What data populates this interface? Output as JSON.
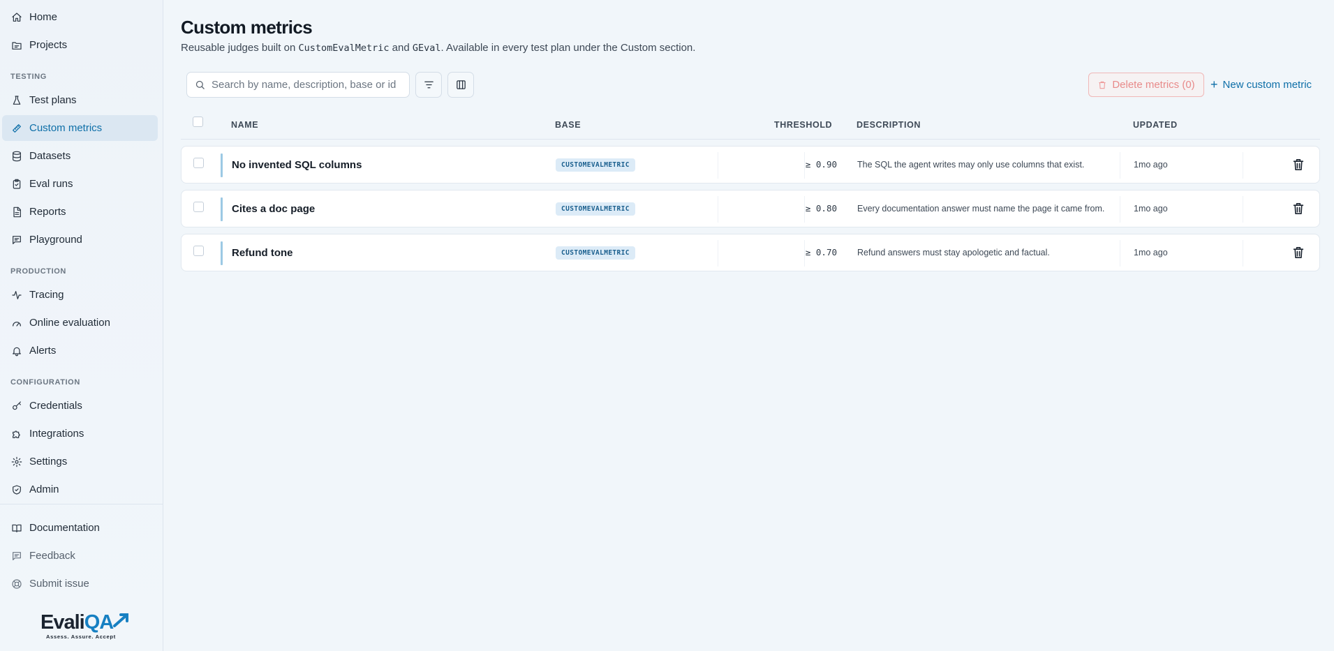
{
  "sidebar": {
    "items_top": [
      {
        "label": "Home",
        "icon": "home-icon"
      },
      {
        "label": "Projects",
        "icon": "projects-icon"
      }
    ],
    "sections": {
      "testing": "TESTING",
      "production": "PRODUCTION",
      "configuration": "CONFIGURATION"
    },
    "testing_items": [
      {
        "label": "Test plans",
        "icon": "flask-icon"
      },
      {
        "label": "Custom metrics",
        "icon": "ruler-icon",
        "active": true
      },
      {
        "label": "Datasets",
        "icon": "database-icon"
      },
      {
        "label": "Eval runs",
        "icon": "clipboard-check-icon"
      },
      {
        "label": "Reports",
        "icon": "file-text-icon"
      },
      {
        "label": "Playground",
        "icon": "chat-icon"
      }
    ],
    "production_items": [
      {
        "label": "Tracing",
        "icon": "activity-icon"
      },
      {
        "label": "Online evaluation",
        "icon": "gauge-icon"
      },
      {
        "label": "Alerts",
        "icon": "bell-icon"
      }
    ],
    "configuration_items": [
      {
        "label": "Credentials",
        "icon": "key-icon"
      },
      {
        "label": "Integrations",
        "icon": "puzzle-icon"
      },
      {
        "label": "Settings",
        "icon": "gear-icon"
      },
      {
        "label": "Admin",
        "icon": "shield-check-icon"
      }
    ],
    "footer_items": [
      {
        "label": "Documentation",
        "icon": "book-icon"
      },
      {
        "label": "Feedback",
        "icon": "message-icon"
      },
      {
        "label": "Submit issue",
        "icon": "lifebuoy-icon"
      }
    ],
    "logo": {
      "word_main": "Evali",
      "word_accent": "QA",
      "tagline": "Assess. Assure. Accept"
    }
  },
  "page": {
    "title": "Custom metrics",
    "subtitle_1": "Reusable judges built on ",
    "subtitle_code_1": "CustomEvalMetric",
    "subtitle_2": " and ",
    "subtitle_code_2": "GEval",
    "subtitle_3": ". Available in every test plan under the Custom section."
  },
  "toolbar": {
    "search_placeholder": "Search by name, description, base or id",
    "filter_icon": "filter-icon",
    "columns_icon": "columns-icon",
    "delete_label": "Delete metrics (0)",
    "new_label": "New custom metric"
  },
  "table": {
    "headers": {
      "name": "NAME",
      "base": "BASE",
      "threshold": "THRESHOLD",
      "description": "DESCRIPTION",
      "updated": "UPDATED"
    },
    "rows": [
      {
        "name": "No invented SQL columns",
        "base": "CUSTOMEVALMETRIC",
        "threshold": "≥ 0.90",
        "description": "The SQL the agent writes may only use columns that exist.",
        "updated": "1mo ago"
      },
      {
        "name": "Cites a doc page",
        "base": "CUSTOMEVALMETRIC",
        "threshold": "≥ 0.80",
        "description": "Every documentation answer must name the page it came from.",
        "updated": "1mo ago"
      },
      {
        "name": "Refund tone",
        "base": "CUSTOMEVALMETRIC",
        "threshold": "≥ 0.70",
        "description": "Refund answers must stay apologetic and factual.",
        "updated": "1mo ago"
      }
    ]
  },
  "colors": {
    "accent": "#0e6fa8",
    "active_bg": "#dbe7f2",
    "danger": "#e88a8a",
    "badge_bg": "#dcebf7"
  }
}
